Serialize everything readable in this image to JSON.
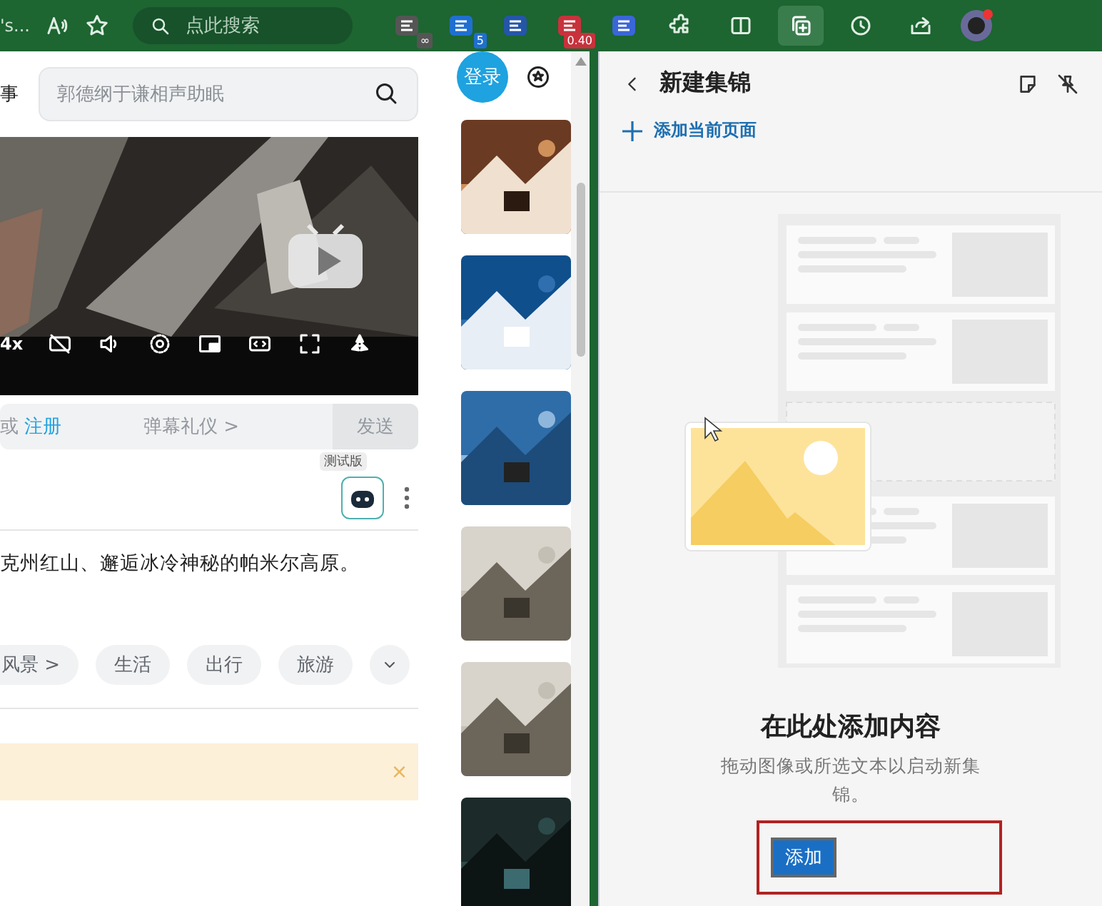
{
  "toolbar": {
    "tab_text": "'s...",
    "search": {
      "placeholder": "点此搜索"
    },
    "extensions": [
      {
        "kind": "badged",
        "badge": "∞"
      },
      {
        "kind": "badged",
        "badge": "5"
      },
      {
        "kind": "plain"
      },
      {
        "kind": "badged",
        "badge": "0.40"
      },
      {
        "kind": "plain"
      }
    ],
    "collections_selected": true
  },
  "page": {
    "header": {
      "cut_text": "事",
      "search": {
        "placeholder": "郭德纲于谦相声助眠"
      },
      "login": "登录"
    },
    "player": {
      "speed": "4x"
    },
    "danmaku": {
      "prefix": "或",
      "register": "注册",
      "etiquette": "弹幕礼仪 >",
      "send": "发送"
    },
    "beta_badge": "测试版",
    "description": "克州红山、邂逅冰冷神秘的帕米尔高原。",
    "tags": [
      "风景 >",
      "生活",
      "出行",
      "旅游"
    ],
    "notice": {
      "close": "×"
    },
    "thumbnails": [
      {
        "kind": "picture"
      },
      {
        "kind": "picture"
      },
      {
        "kind": "picture"
      },
      {
        "kind": "picture"
      },
      {
        "kind": "picture"
      },
      {
        "kind": "picture"
      }
    ]
  },
  "panel": {
    "title": "新建集锦",
    "add_current": "添加当前页面",
    "heading": "在此处添加内容",
    "hint": "拖动图像或所选文本以启动新集锦。",
    "button": "添加"
  }
}
